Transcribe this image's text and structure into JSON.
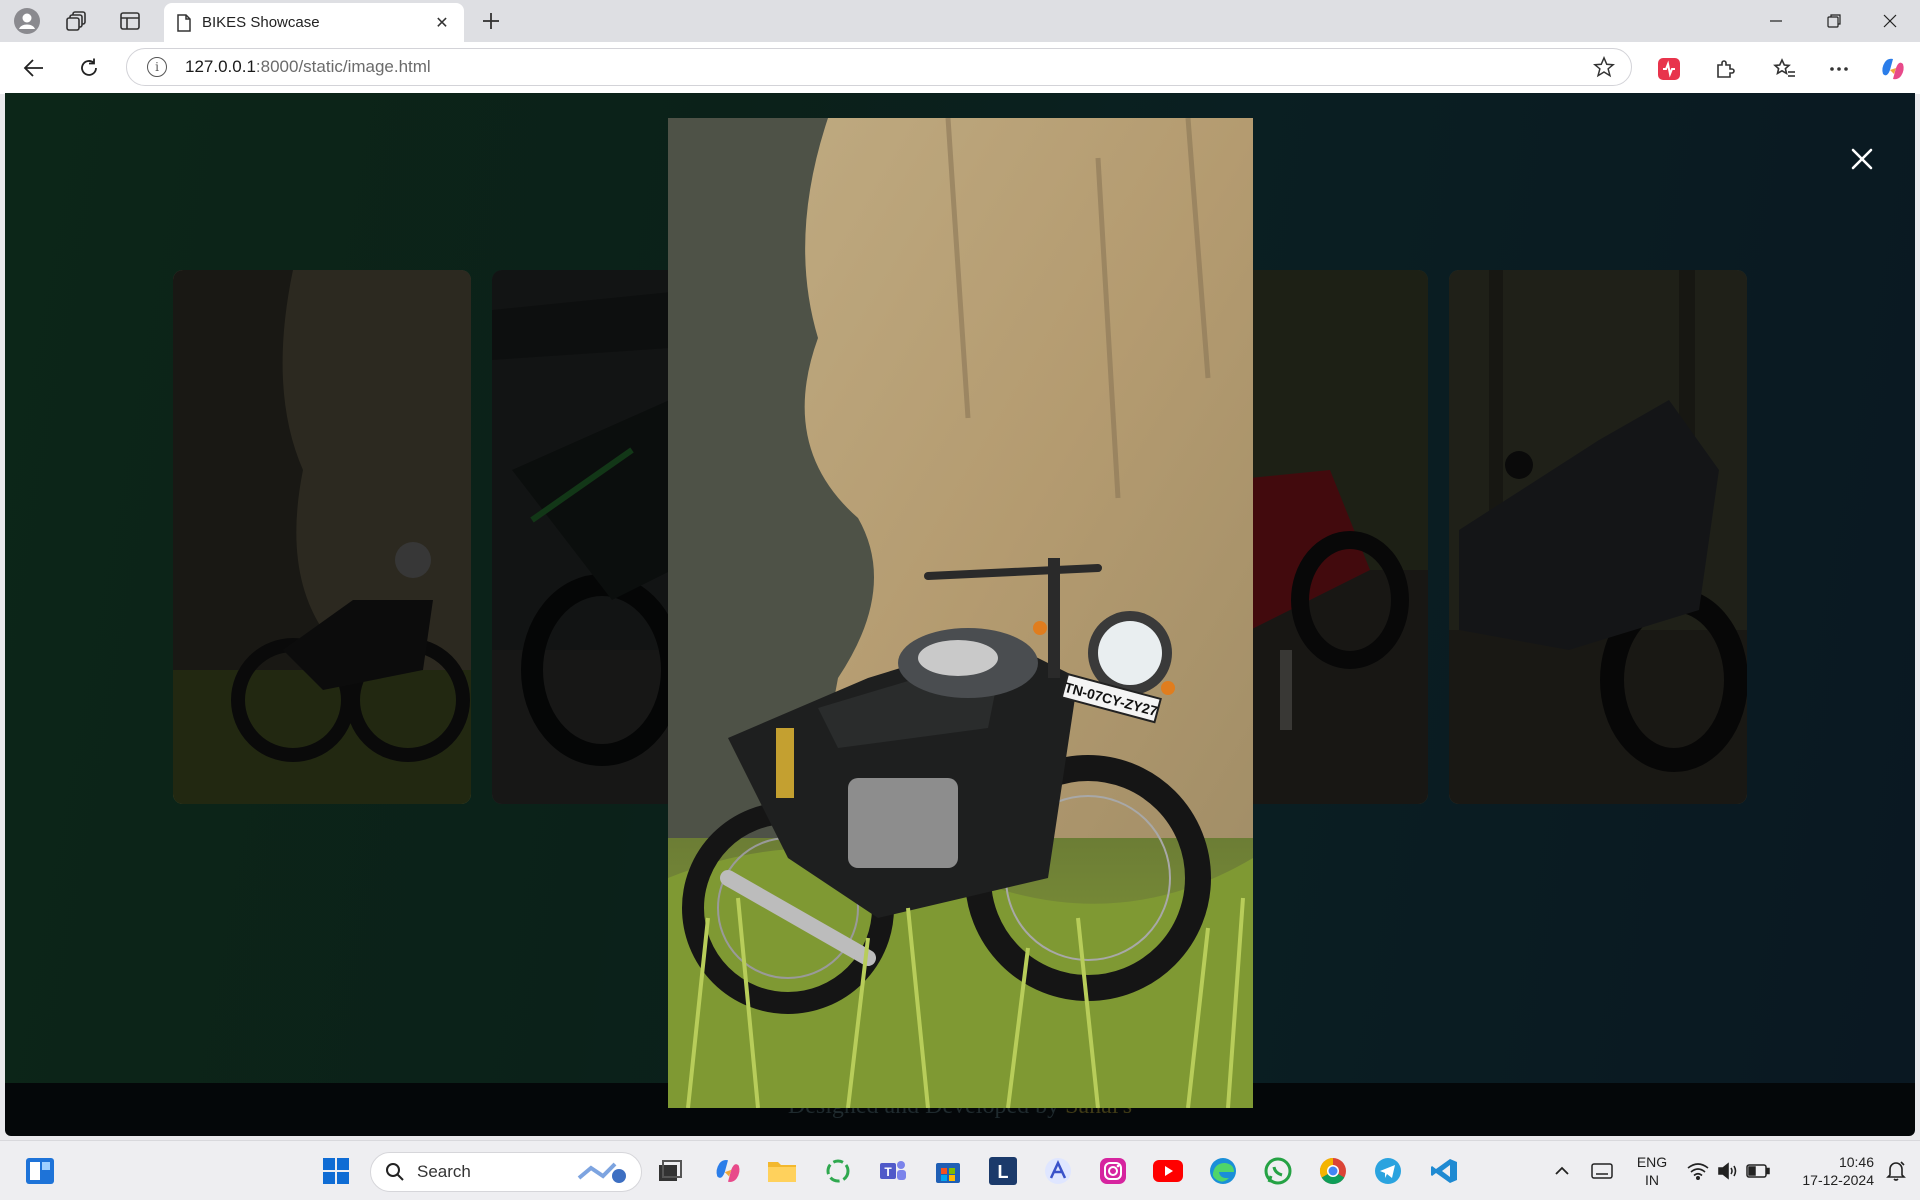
{
  "browser": {
    "tab_title": "BIKES Showcase",
    "url_host": "127.0.0.1",
    "url_path": ":8000/static/image.html"
  },
  "page": {
    "footer_prefix": "Designed and Developed by",
    "footer_name": "Sanal's",
    "close_icon": "close-icon"
  },
  "gallery": {
    "cards": [
      {
        "name": "bike-card-1",
        "scene": "cafe-racer-by-rock-wall"
      },
      {
        "name": "bike-card-2",
        "scene": "green-superbike-on-pavers"
      },
      {
        "name": "bike-card-3",
        "scene": "red-sportbike-on-road"
      },
      {
        "name": "bike-card-4",
        "scene": "black-superbike-in-forest"
      }
    ],
    "lightbox_scene": "cafe-racer-by-rock-wall",
    "plate": "TN-07CY-ZY27"
  },
  "taskbar": {
    "search_placeholder": "Search",
    "language_line1": "ENG",
    "language_line2": "IN",
    "time": "10:46",
    "date": "17-12-2024"
  }
}
